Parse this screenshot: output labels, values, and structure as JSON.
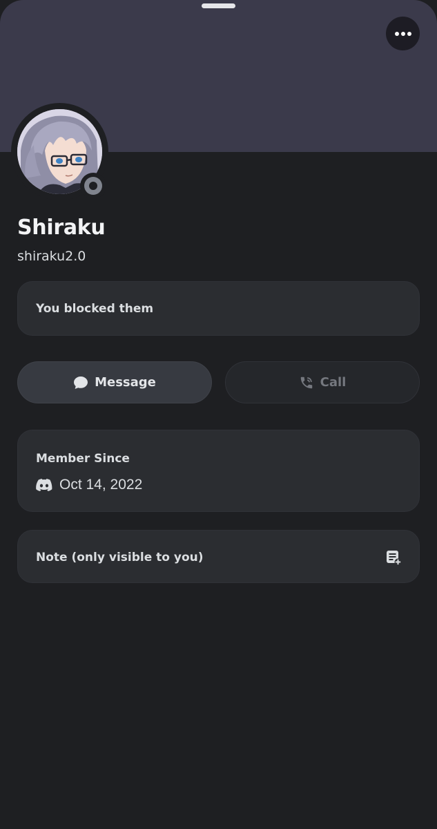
{
  "profile": {
    "display_name": "Shiraku",
    "username": "shiraku2.0",
    "status": "offline",
    "banner_color": "#3b3a4b"
  },
  "header": {
    "more_icon": "more-horizontal-icon"
  },
  "blocked_notice": {
    "text": "You blocked them"
  },
  "actions": {
    "message_label": "Message",
    "message_icon": "chat-bubble-icon",
    "call_label": "Call",
    "call_icon": "phone-icon"
  },
  "member_since": {
    "heading": "Member Since",
    "icon": "discord-logo-icon",
    "date": "Oct 14, 2022"
  },
  "note": {
    "label": "Note (only visible to you)",
    "icon": "add-note-icon"
  }
}
